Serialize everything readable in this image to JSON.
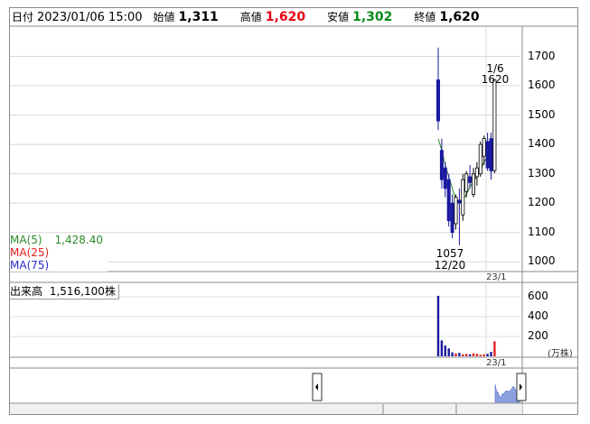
{
  "info": {
    "date_label": "日付",
    "date_value": "2023/01/06 15:00",
    "open_label": "始値",
    "open_value": "1,311",
    "high_label": "高値",
    "high_value": "1,620",
    "low_label": "安値",
    "low_value": "1,302",
    "close_label": "終値",
    "close_value": "1,620"
  },
  "legend": {
    "ma5_label": "MA(5)",
    "ma5_value": "1,428.40",
    "ma25_label": "MA(25)",
    "ma75_label": "MA(75)"
  },
  "annotations": {
    "high_date": "1/6",
    "high_value": "1620",
    "low_value": "1057",
    "low_date": "12/20"
  },
  "price_axis": {
    "ticks": [
      "1700",
      "1600",
      "1500",
      "1400",
      "1300",
      "1200",
      "1100",
      "1000"
    ],
    "x_tick": "23/1"
  },
  "volume": {
    "header_label": "出来高",
    "header_value": "1,516,100株",
    "ticks": [
      "600",
      "400",
      "200"
    ],
    "unit": "(万株)",
    "x_tick": "23/1"
  },
  "colors": {
    "down_candle": "#1a1aa0",
    "up_candle": "#ffffff",
    "ma5": "#2a8a2a",
    "ma25": "#e62020",
    "ma75": "#2a2ad0",
    "vol_down": "#1a1aa0",
    "vol_up": "#e62020",
    "nav_area": "#8ca0e0"
  },
  "chart_data": {
    "type": "candlestick",
    "price_ylim": [
      970,
      1800
    ],
    "candles": [
      {
        "o": 1620,
        "h": 1730,
        "l": 1450,
        "c": 1480
      },
      {
        "o": 1380,
        "h": 1420,
        "l": 1250,
        "c": 1280
      },
      {
        "o": 1320,
        "h": 1340,
        "l": 1220,
        "c": 1250
      },
      {
        "o": 1280,
        "h": 1300,
        "l": 1120,
        "c": 1140
      },
      {
        "o": 1200,
        "h": 1230,
        "l": 1080,
        "c": 1100
      },
      {
        "o": 1130,
        "h": 1230,
        "l": 1110,
        "c": 1220
      },
      {
        "o": 1210,
        "h": 1250,
        "l": 1057,
        "c": 1200
      },
      {
        "o": 1160,
        "h": 1300,
        "l": 1140,
        "c": 1280
      },
      {
        "o": 1240,
        "h": 1310,
        "l": 1220,
        "c": 1300
      },
      {
        "o": 1290,
        "h": 1330,
        "l": 1250,
        "c": 1270
      },
      {
        "o": 1230,
        "h": 1320,
        "l": 1220,
        "c": 1300
      },
      {
        "o": 1290,
        "h": 1340,
        "l": 1260,
        "c": 1320
      },
      {
        "o": 1300,
        "h": 1410,
        "l": 1290,
        "c": 1400
      },
      {
        "o": 1360,
        "h": 1430,
        "l": 1330,
        "c": 1420
      },
      {
        "o": 1410,
        "h": 1440,
        "l": 1310,
        "c": 1320
      },
      {
        "o": 1420,
        "h": 1440,
        "l": 1280,
        "c": 1310
      },
      {
        "o": 1311,
        "h": 1620,
        "l": 1302,
        "c": 1620
      }
    ],
    "ma5": [
      1420,
      1380,
      1330,
      1290,
      1250,
      1210,
      1200,
      1210,
      1230,
      1255,
      1275,
      1290,
      1310,
      1340,
      1360,
      1370,
      1428.4
    ],
    "volume_ylim": [
      0,
      700
    ],
    "volume": [
      610,
      160,
      110,
      80,
      40,
      30,
      35,
      20,
      25,
      20,
      30,
      25,
      15,
      20,
      25,
      45,
      151.61
    ]
  }
}
